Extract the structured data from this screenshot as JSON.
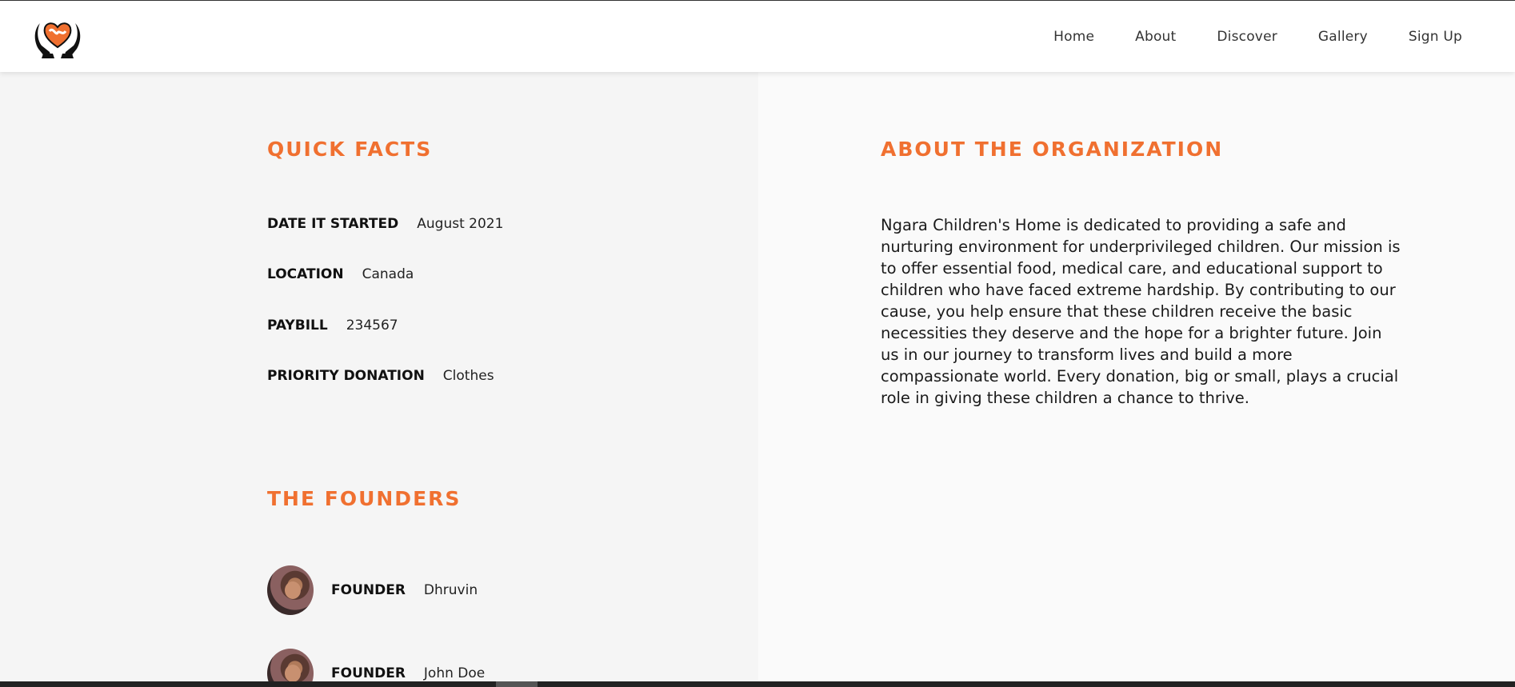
{
  "header": {
    "logo_icon": "hands-heart-logo-icon",
    "nav": [
      {
        "label": "Home"
      },
      {
        "label": "About"
      },
      {
        "label": "Discover"
      },
      {
        "label": "Gallery"
      },
      {
        "label": "Sign Up"
      }
    ]
  },
  "colors": {
    "accent": "#f07030",
    "left_bg": "#f5f5f5",
    "right_bg": "#fafafa"
  },
  "quick_facts": {
    "title": "QUICK FACTS",
    "items": [
      {
        "label": "DATE IT STARTED",
        "value": "August 2021"
      },
      {
        "label": "LOCATION",
        "value": "Canada"
      },
      {
        "label": "PAYBILL",
        "value": "234567"
      },
      {
        "label": "PRIORITY DONATION",
        "value": "Clothes"
      }
    ]
  },
  "founders": {
    "title": "THE FOUNDERS",
    "items": [
      {
        "label": "FOUNDER",
        "name": "Dhruvin"
      },
      {
        "label": "FOUNDER",
        "name": "John Doe"
      }
    ]
  },
  "about": {
    "title": "ABOUT THE ORGANIZATION",
    "text": "Ngara Children's Home is dedicated to providing a safe and nurturing environment for underprivileged children. Our mission is to offer essential food, medical care, and educational support to children who have faced extreme hardship. By contributing to our cause, you help ensure that these children receive the basic necessities they deserve and the hope for a brighter future. Join us in our journey to transform lives and build a more compassionate world. Every donation, big or small, plays a crucial role in giving these children a chance to thrive."
  }
}
